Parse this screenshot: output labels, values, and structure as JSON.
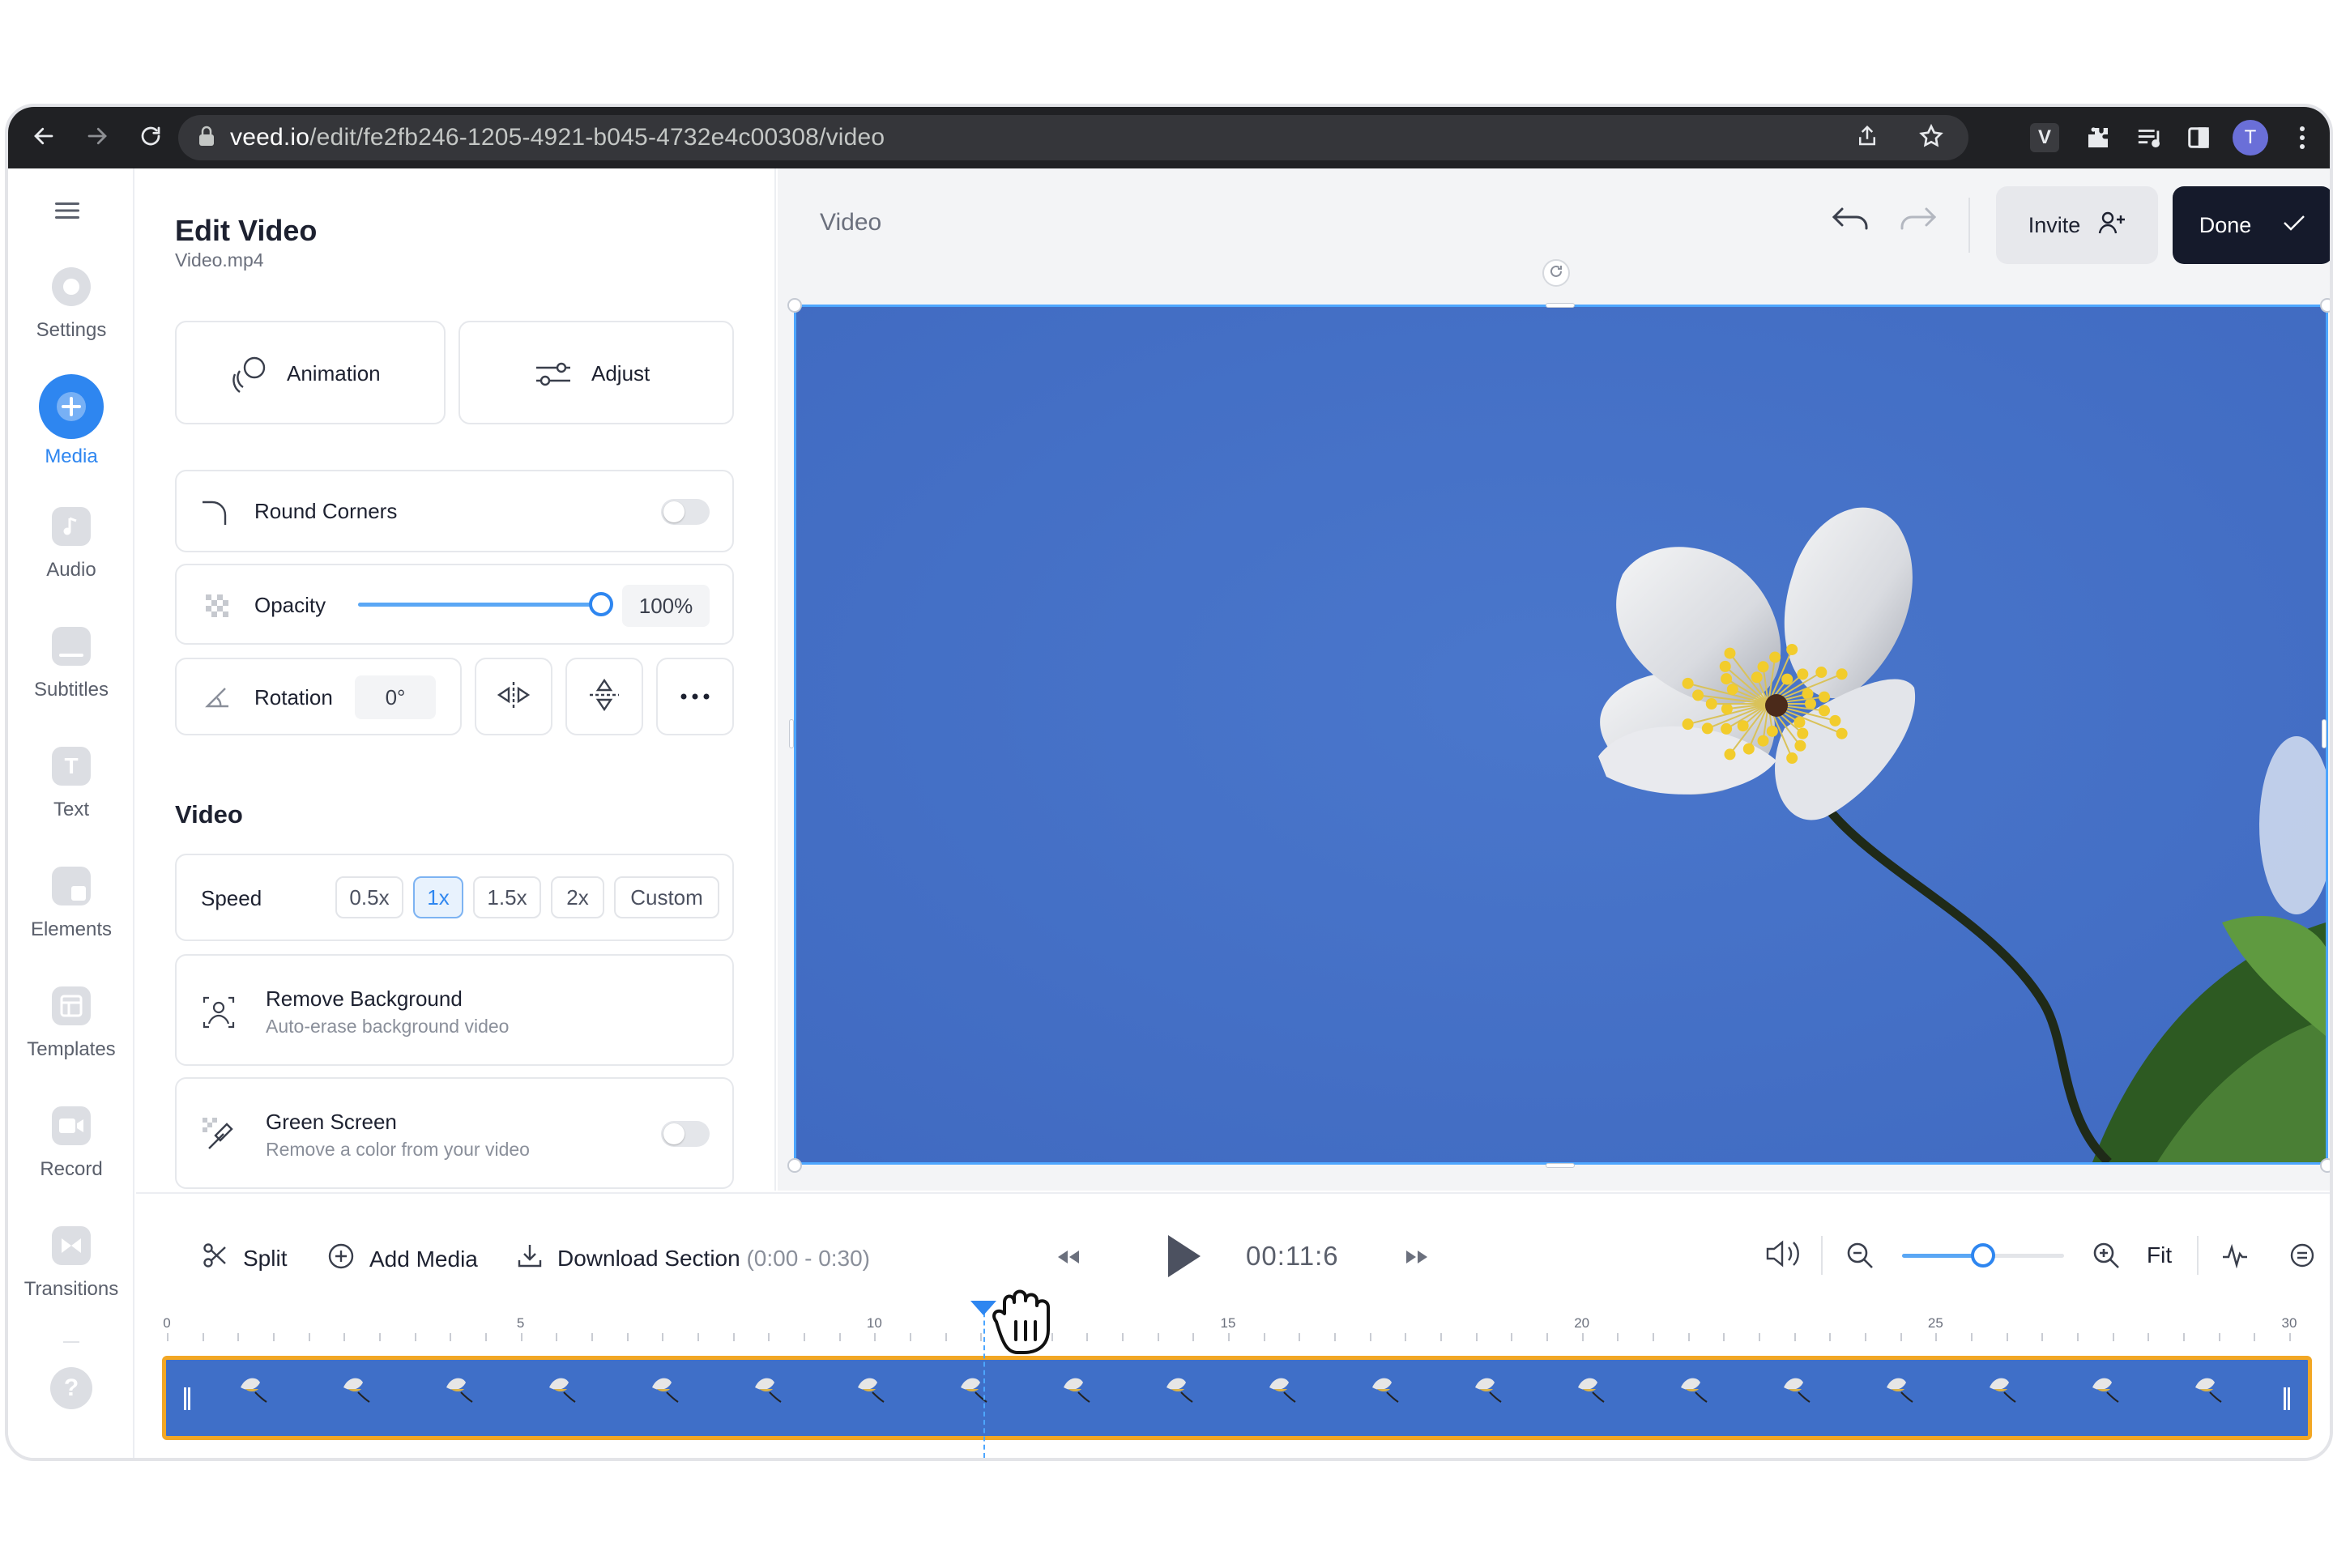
{
  "browser": {
    "url_domain": "veed.io",
    "url_path": "/edit/fe2fb246-1205-4921-b045-4732e4c00308/video",
    "profile_initial": "T",
    "extension_letter": "V"
  },
  "rail": {
    "items": [
      {
        "label": "Settings",
        "icon": "gear-icon"
      },
      {
        "label": "Media",
        "icon": "plus-icon",
        "active": true
      },
      {
        "label": "Audio",
        "icon": "music-note-icon"
      },
      {
        "label": "Subtitles",
        "icon": "subtitles-icon"
      },
      {
        "label": "Text",
        "icon": "text-icon",
        "glyph": "T"
      },
      {
        "label": "Elements",
        "icon": "elements-icon"
      },
      {
        "label": "Templates",
        "icon": "templates-icon"
      },
      {
        "label": "Record",
        "icon": "record-icon"
      },
      {
        "label": "Transitions",
        "icon": "transitions-icon"
      }
    ],
    "help_glyph": "?"
  },
  "panel": {
    "title": "Edit Video",
    "filename": "Video.mp4",
    "animation_label": "Animation",
    "adjust_label": "Adjust",
    "round_corners_label": "Round Corners",
    "round_corners_on": false,
    "opacity_label": "Opacity",
    "opacity_value": "100%",
    "opacity_level": 1.0,
    "rotation_label": "Rotation",
    "rotation_value": "0°",
    "video_section": "Video",
    "speed_label": "Speed",
    "speed_options": [
      "0.5x",
      "1x",
      "1.5x",
      "2x",
      "Custom"
    ],
    "speed_selected": "1x",
    "remove_bg_title": "Remove Background",
    "remove_bg_desc": "Auto-erase background video",
    "green_screen_title": "Green Screen",
    "green_screen_desc": "Remove a color from your video",
    "green_screen_on": false
  },
  "canvas": {
    "title": "Video",
    "invite_label": "Invite",
    "done_label": "Done"
  },
  "timeline": {
    "split_label": "Split",
    "add_media_label": "Add Media",
    "download_label": "Download Section",
    "download_range": "(0:00 - 0:30)",
    "current_time": "00:11:6",
    "fit_label": "Fit",
    "ruler_labels": [
      "0",
      "5",
      "10",
      "15",
      "20",
      "25",
      "30"
    ],
    "zoom_level": 0.5
  },
  "colors": {
    "accent": "#2e86f0",
    "done_bg": "#151a2b",
    "track_border": "#f2a724",
    "video_bg": "#4571c8"
  }
}
